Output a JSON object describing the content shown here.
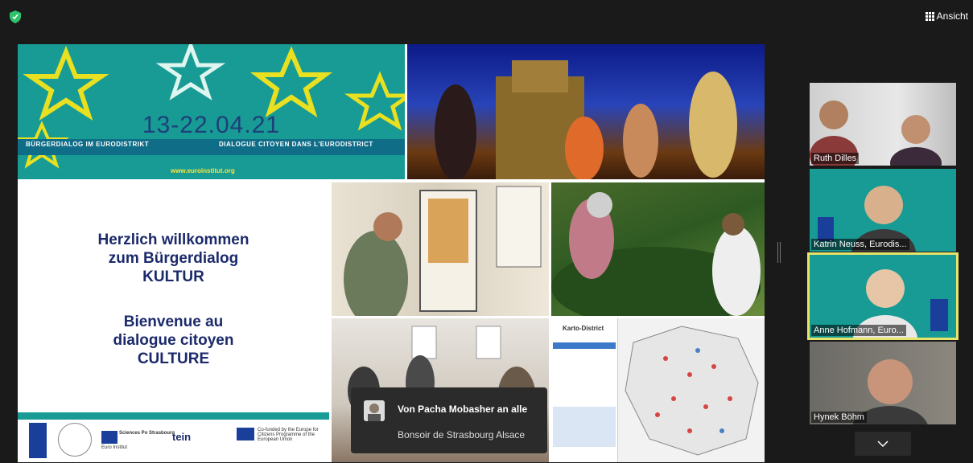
{
  "toolbar": {
    "view_label": "Ansicht"
  },
  "banner": {
    "date": "13-22.04.21",
    "title_de": "BÜRGERDIALOG IM EURODISTRIKT",
    "title_fr": "DIALOGUE CITOYEN DANS L'EURODISTRICT",
    "url": "www.euroinstitut.org"
  },
  "welcome": {
    "line1": "Herzlich willkommen",
    "line2": "zum Bürgerdialog",
    "line3": "KULTUR",
    "line4": "Bienvenue au",
    "line5": "dialogue citoyen",
    "line6": "CULTURE"
  },
  "logos": {
    "eucor": "Euro Institut",
    "sciencespo": "Sciences Po Strasbourg",
    "tein": "tein",
    "eu_text": "Co-funded by the Europe for Citizens Programme of the European Union"
  },
  "map_panel": {
    "title": "Karto-District"
  },
  "chat": {
    "from": "Von Pacha Mobasher an alle",
    "message": "Bonsoir de Strasbourg Alsace"
  },
  "participants": [
    {
      "name": "Ruth Dilles"
    },
    {
      "name": "Katrin Neuss, Eurodis..."
    },
    {
      "name": "Anne Hofmann, Euro..."
    },
    {
      "name": "Hynek Böhm"
    }
  ],
  "colors": {
    "teal": "#179b94",
    "navy_text": "#1b2a6b",
    "active_speaker": "#e8e36a"
  }
}
